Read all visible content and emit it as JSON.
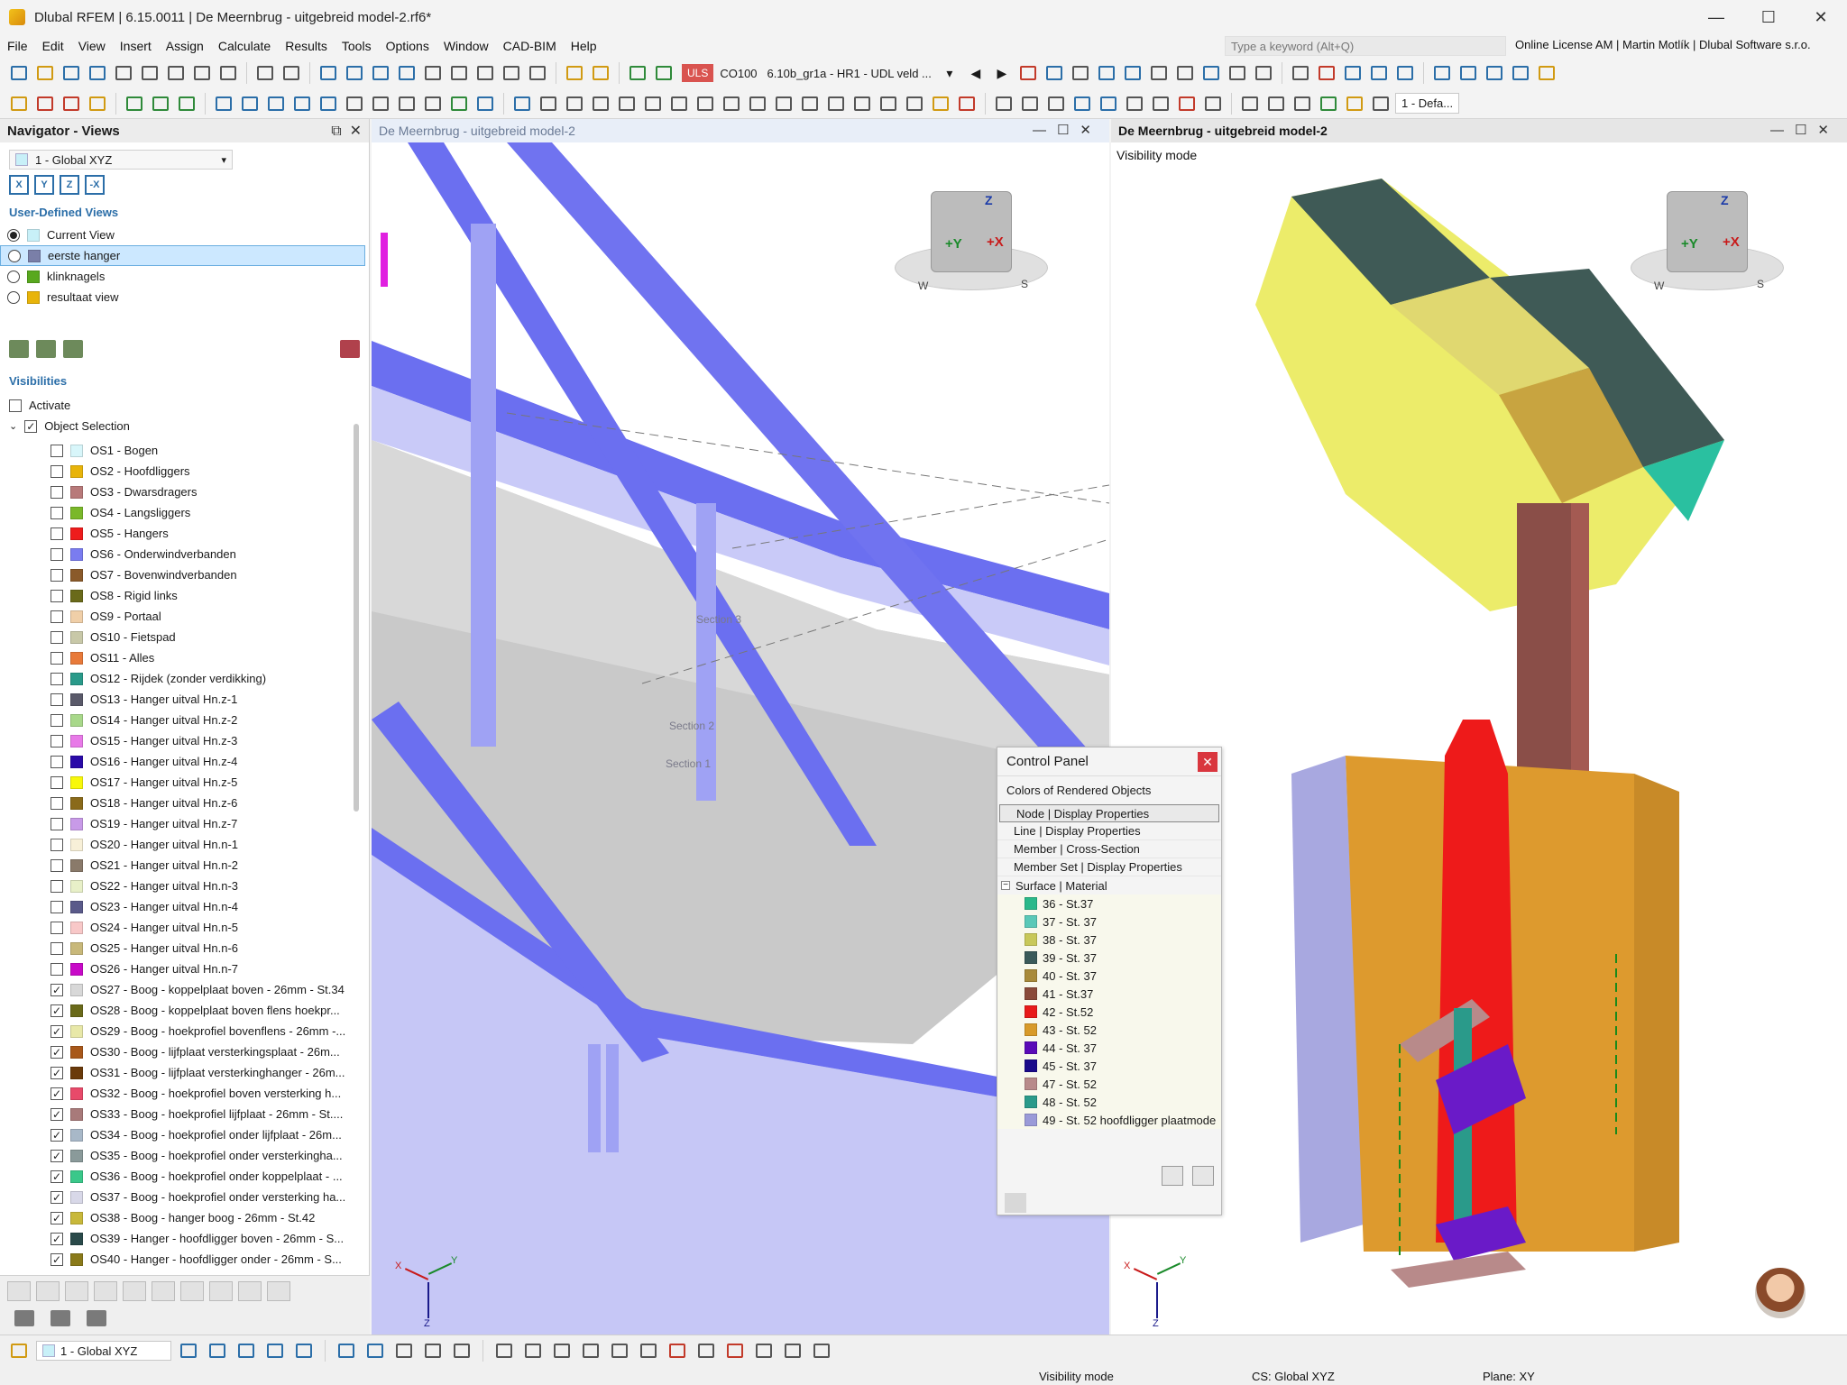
{
  "window": {
    "title": "Dlubal RFEM | 6.15.0011 | De Meernbrug - uitgebreid model-2.rf6*",
    "controls": [
      "—",
      "☐",
      "✕"
    ]
  },
  "menu": {
    "items": [
      "File",
      "Edit",
      "View",
      "Insert",
      "Assign",
      "Calculate",
      "Results",
      "Tools",
      "Options",
      "Window",
      "CAD-BIM",
      "Help"
    ],
    "search_placeholder": "Type a keyword (Alt+Q)",
    "license": "Online License AM | Martin Motlík | Dlubal Software s.r.o."
  },
  "toolbar": {
    "uls_label": "ULS",
    "combo_id": "CO100",
    "combo_desc": "6.10b_gr1a - HR1 - UDL veld ...",
    "view_combo": "1 - Defa..."
  },
  "navigator": {
    "title": "Navigator - Views",
    "view_combo": "1 - Global XYZ",
    "user_views_title": "User-Defined Views",
    "user_views": [
      {
        "label": "Current View",
        "color": "#c8f0f8",
        "selected": true
      },
      {
        "label": "eerste hanger",
        "color": "#7a7fa8",
        "selected": false
      },
      {
        "label": "klinknagels",
        "color": "#58a81e",
        "selected": false
      },
      {
        "label": "resultaat view",
        "color": "#e8b40a",
        "selected": false
      }
    ],
    "visibilities_title": "Visibilities",
    "activate_label": "Activate",
    "object_selection_label": "Object Selection",
    "object_sets": [
      {
        "label": "OS1 - Bogen",
        "color": "#d8f6fa",
        "checked": false
      },
      {
        "label": "OS2 - Hoofdliggers",
        "color": "#e8b40a",
        "checked": false
      },
      {
        "label": "OS3 - Dwarsdragers",
        "color": "#b87a7a",
        "checked": false
      },
      {
        "label": "OS4 - Langsliggers",
        "color": "#7ab82a",
        "checked": false
      },
      {
        "label": "OS5 - Hangers",
        "color": "#ee1c1c",
        "checked": false
      },
      {
        "label": "OS6 - Onderwindverbanden",
        "color": "#7a7cf0",
        "checked": false
      },
      {
        "label": "OS7 - Bovenwindverbanden",
        "color": "#8a5a2a",
        "checked": false
      },
      {
        "label": "OS8 - Rigid links",
        "color": "#6a6a1a",
        "checked": false
      },
      {
        "label": "OS9 - Portaal",
        "color": "#f0cfa8",
        "checked": false
      },
      {
        "label": "OS10 - Fietspad",
        "color": "#c8c8a8",
        "checked": false
      },
      {
        "label": "OS11 - Alles",
        "color": "#e87a3a",
        "checked": false
      },
      {
        "label": "OS12 - Rijdek (zonder verdikking)",
        "color": "#2a9a8a",
        "checked": false
      },
      {
        "label": "OS13 - Hanger uitval Hn.z-1",
        "color": "#5a5a6a",
        "checked": false
      },
      {
        "label": "OS14 - Hanger uitval Hn.z-2",
        "color": "#a8d88a",
        "checked": false
      },
      {
        "label": "OS15 - Hanger uitval Hn.z-3",
        "color": "#e87ae8",
        "checked": false
      },
      {
        "label": "OS16 - Hanger uitval Hn.z-4",
        "color": "#2a0aa8",
        "checked": false
      },
      {
        "label": "OS17 - Hanger uitval Hn.z-5",
        "color": "#f8f80a",
        "checked": false
      },
      {
        "label": "OS18 - Hanger uitval Hn.z-6",
        "color": "#8a6a1a",
        "checked": false
      },
      {
        "label": "OS19 - Hanger uitval Hn.z-7",
        "color": "#c89ae8",
        "checked": false
      },
      {
        "label": "OS20 - Hanger uitval Hn.n-1",
        "color": "#f8f0d8",
        "checked": false
      },
      {
        "label": "OS21 - Hanger uitval Hn.n-2",
        "color": "#8a7a6a",
        "checked": false
      },
      {
        "label": "OS22 - Hanger uitval Hn.n-3",
        "color": "#e8f0c8",
        "checked": false
      },
      {
        "label": "OS23 - Hanger uitval Hn.n-4",
        "color": "#5a5a8a",
        "checked": false
      },
      {
        "label": "OS24 - Hanger uitval Hn.n-5",
        "color": "#f8c8c8",
        "checked": false
      },
      {
        "label": "OS25 - Hanger uitval Hn.n-6",
        "color": "#c8b87a",
        "checked": false
      },
      {
        "label": "OS26 - Hanger uitval Hn.n-7",
        "color": "#c80ac8",
        "checked": false
      },
      {
        "label": "OS27 - Boog - koppelplaat boven - 26mm - St.34",
        "color": "#d8d8d8",
        "checked": true
      },
      {
        "label": "OS28 - Boog - koppelplaat boven flens hoekpr...",
        "color": "#6a6a1a",
        "checked": true
      },
      {
        "label": "OS29 - Boog - hoekprofiel bovenflens - 26mm -...",
        "color": "#e8e8a8",
        "checked": true
      },
      {
        "label": "OS30 - Boog - lijfplaat versterkingsplaat - 26m...",
        "color": "#a8581a",
        "checked": true
      },
      {
        "label": "OS31 - Boog - lijfplaat versterkinghanger - 26m...",
        "color": "#6a3a0a",
        "checked": true
      },
      {
        "label": "OS32 - Boog - hoekprofiel boven versterking h...",
        "color": "#e84a6a",
        "checked": true
      },
      {
        "label": "OS33 - Boog - hoekprofiel lijfplaat - 26mm - St....",
        "color": "#a87a7a",
        "checked": true
      },
      {
        "label": "OS34 - Boog - hoekprofiel onder lijfplaat - 26m...",
        "color": "#a8b8c8",
        "checked": true
      },
      {
        "label": "OS35 - Boog - hoekprofiel onder versterkingha...",
        "color": "#8a9a9a",
        "checked": true
      },
      {
        "label": "OS36 - Boog - hoekprofiel onder koppelplaat - ...",
        "color": "#3ac88a",
        "checked": true
      },
      {
        "label": "OS37 - Boog - hoekprofiel onder versterking ha...",
        "color": "#d8d8e8",
        "checked": true
      },
      {
        "label": "OS38 - Boog - hanger boog - 26mm - St.42",
        "color": "#c8b83a",
        "checked": true
      },
      {
        "label": "OS39 - Hanger - hoofdligger boven - 26mm - S...",
        "color": "#2a4a4a",
        "checked": true
      },
      {
        "label": "OS40 - Hanger - hoofdligger onder - 26mm - S...",
        "color": "#8a7a1a",
        "checked": true
      }
    ]
  },
  "viewport_left": {
    "title": "De Meernbrug - uitgebreid model-2",
    "section_labels": [
      "Section 3",
      "Section 2",
      "Section 1"
    ],
    "cube_labels": {
      "z": "Z",
      "y": "+Y",
      "x": "+X",
      "w": "W",
      "s": "S"
    },
    "axis_labels": {
      "x": "X",
      "y": "Y",
      "z": "Z"
    }
  },
  "viewport_right": {
    "title": "De Meernbrug - uitgebreid model-2",
    "mode": "Visibility mode",
    "cube_labels": {
      "z": "Z",
      "y": "+Y",
      "x": "+X",
      "w": "W",
      "s": "S"
    },
    "axis_labels": {
      "x": "X",
      "y": "Y",
      "z": "Z"
    }
  },
  "control_panel": {
    "title": "Control Panel",
    "subtitle": "Colors of Rendered Objects",
    "items": [
      "Node | Display Properties",
      "Line | Display Properties",
      "Member | Cross-Section",
      "Member Set | Display Properties"
    ],
    "tree_label": "Surface | Material",
    "materials": [
      {
        "label": "36 - St.37",
        "color": "#2ab88a"
      },
      {
        "label": "37 - St. 37",
        "color": "#5ac8b8"
      },
      {
        "label": "38 - St. 37",
        "color": "#c8c85a"
      },
      {
        "label": "39 - St. 37",
        "color": "#3a5a5a"
      },
      {
        "label": "40 - St. 37",
        "color": "#a88a3a"
      },
      {
        "label": "41 - St.37",
        "color": "#8a4a3a"
      },
      {
        "label": "42 - St.52",
        "color": "#e81a1a"
      },
      {
        "label": "43 - St. 52",
        "color": "#d89a2a"
      },
      {
        "label": "44 - St. 37",
        "color": "#5a0ab8"
      },
      {
        "label": "45 - St. 37",
        "color": "#1a0a8a"
      },
      {
        "label": "47 - St. 52",
        "color": "#b88a8a"
      },
      {
        "label": "48 - St. 52",
        "color": "#2a9a8a"
      },
      {
        "label": "49 - St. 52 hoofdligger plaatmode",
        "color": "#9a9ad8"
      }
    ]
  },
  "statusbar": {
    "view_combo": "1 - Global XYZ",
    "mode": "Visibility mode",
    "cs": "CS: Global XYZ",
    "plane": "Plane: XY"
  }
}
